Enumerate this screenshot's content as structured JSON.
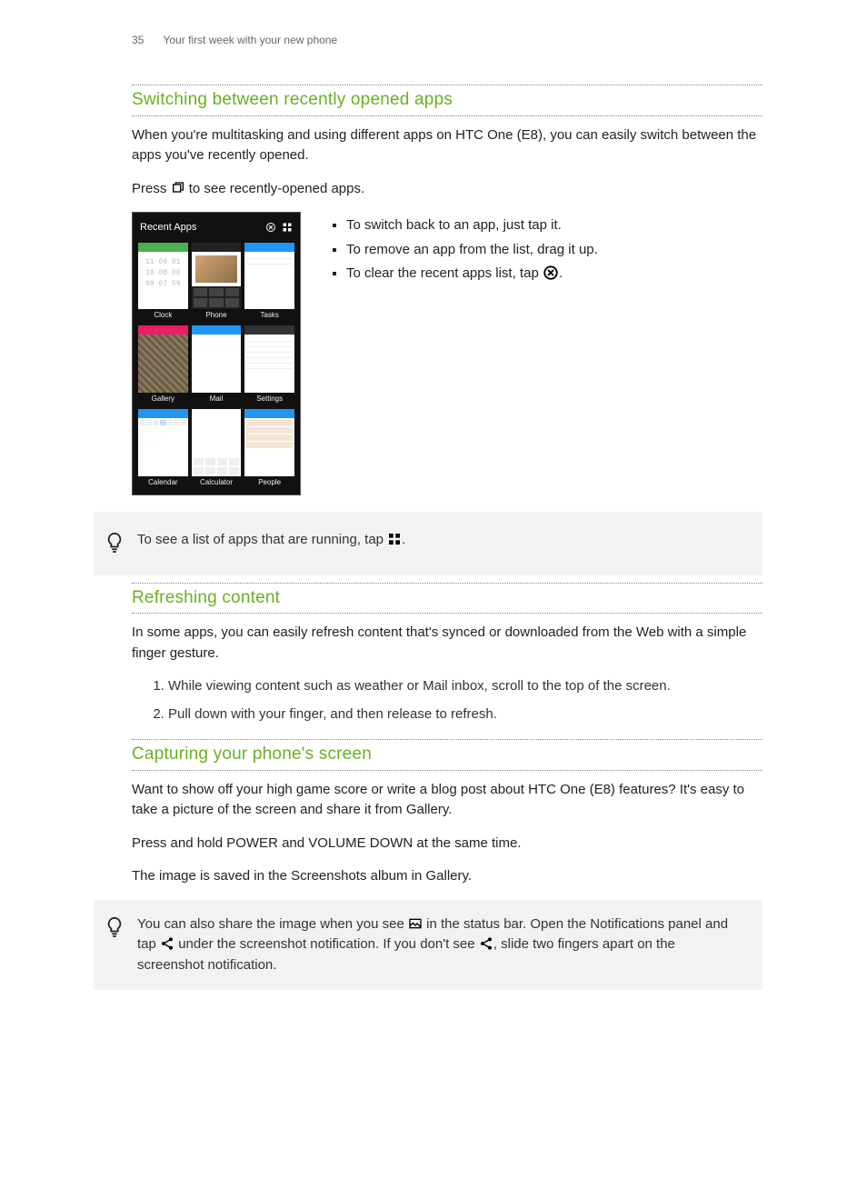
{
  "header": {
    "page": "35",
    "section": "Your first week with your new phone"
  },
  "s1": {
    "title": "Switching between recently opened apps",
    "p1": "When you're multitasking and using different apps on HTC One (E8), you can easily switch between the apps you've recently opened.",
    "p2a": "Press ",
    "p2b": " to see recently-opened apps.",
    "bul1": "To switch back to an app, just tap it.",
    "bul2": "To remove an app from the list, drag it up.",
    "bul3a": "To clear the recent apps list, tap ",
    "bul3b": "."
  },
  "shot": {
    "title": "Recent Apps",
    "apps": [
      "Clock",
      "Phone",
      "Tasks",
      "Gallery",
      "Mail",
      "Settings",
      "Calendar",
      "Calculator",
      "People"
    ]
  },
  "tip1": {
    "a": "To see a list of apps that are running, tap ",
    "b": "."
  },
  "s2": {
    "title": "Refreshing content",
    "p1": "In some apps, you can easily refresh content that's synced or downloaded from the Web with a simple finger gesture.",
    "li1": "While viewing content such as weather or Mail inbox, scroll to the top of the screen.",
    "li2": "Pull down with your finger, and then release to refresh."
  },
  "s3": {
    "title": "Capturing your phone's screen",
    "p1": "Want to show off your high game score or write a blog post about HTC One (E8) features? It's easy to take a picture of the screen and share it from Gallery.",
    "p2": "Press and hold POWER and VOLUME DOWN at the same time.",
    "p3": "The image is saved in the Screenshots album in Gallery."
  },
  "tip2": {
    "a": "You can also share the image when you see ",
    "b": " in the status bar. Open the Notifications panel and tap ",
    "c": " under the screenshot notification. If you don't see ",
    "d": ", slide two fingers apart on the screenshot notification."
  }
}
